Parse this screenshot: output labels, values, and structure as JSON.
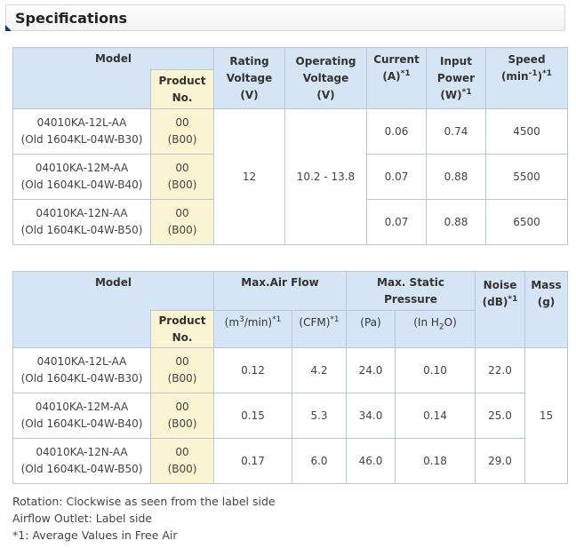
{
  "header": {
    "title": "Specifications"
  },
  "table1": {
    "headers": {
      "model": "Model",
      "product_no_l1": "Product",
      "product_no_l2": "No.",
      "rating_voltage_l1": "Rating",
      "rating_voltage_l2": "Voltage",
      "rating_voltage_l3": "(V)",
      "operating_voltage_l1": "Operating",
      "operating_voltage_l2": "Voltage",
      "operating_voltage_l3": "(V)",
      "current_l1": "Current",
      "current_l2": "(A)",
      "current_sup": "*1",
      "input_power_l1": "Input",
      "input_power_l2": "Power",
      "input_power_l3": "(W)",
      "input_power_sup": "*1",
      "speed_l1": "Speed",
      "speed_l2a": "(min",
      "speed_exp": "-1",
      "speed_l2b": ")",
      "speed_sup": "*1"
    },
    "rows": [
      {
        "model": "04010KA-12L-AA",
        "old": "(Old 1604KL-04W-B30)",
        "prod": "00",
        "prod_old": "(B00)",
        "current": "0.06",
        "power": "0.74",
        "speed": "4500"
      },
      {
        "model": "04010KA-12M-AA",
        "old": "(Old 1604KL-04W-B40)",
        "prod": "00",
        "prod_old": "(B00)",
        "current": "0.07",
        "power": "0.88",
        "speed": "5500"
      },
      {
        "model": "04010KA-12N-AA",
        "old": "(Old 1604KL-04W-B50)",
        "prod": "00",
        "prod_old": "(B00)",
        "current": "0.07",
        "power": "0.88",
        "speed": "6500"
      }
    ],
    "rating_voltage": "12",
    "operating_voltage": "10.2 - 13.8"
  },
  "table2": {
    "headers": {
      "model": "Model",
      "product_no_l1": "Product",
      "product_no_l2": "No.",
      "airflow": "Max.Air Flow",
      "m3_a": "(m",
      "m3_exp": "3",
      "m3_b": "/min)",
      "m3_sup": "*1",
      "cfm": "(CFM)",
      "cfm_sup": "*1",
      "pressure_l1": "Max. Static",
      "pressure_l2": "Pressure",
      "pa": "(Pa)",
      "inh2o_a": "(In H",
      "inh2o_sub": "2",
      "inh2o_b": "O)",
      "noise_l1": "Noise",
      "noise_l2": "(dB)",
      "noise_sup": "*1",
      "mass_l1": "Mass",
      "mass_l2": "(g)"
    },
    "rows": [
      {
        "model": "04010KA-12L-AA",
        "old": "(Old 1604KL-04W-B30)",
        "prod": "00",
        "prod_old": "(B00)",
        "m3": "0.12",
        "cfm": "4.2",
        "pa": "24.0",
        "inh2o": "0.10",
        "noise": "22.0"
      },
      {
        "model": "04010KA-12M-AA",
        "old": "(Old 1604KL-04W-B40)",
        "prod": "00",
        "prod_old": "(B00)",
        "m3": "0.15",
        "cfm": "5.3",
        "pa": "34.0",
        "inh2o": "0.14",
        "noise": "25.0"
      },
      {
        "model": "04010KA-12N-AA",
        "old": "(Old 1604KL-04W-B50)",
        "prod": "00",
        "prod_old": "(B00)",
        "m3": "0.17",
        "cfm": "6.0",
        "pa": "46.0",
        "inh2o": "0.18",
        "noise": "29.0"
      }
    ],
    "mass": "15"
  },
  "footnotes": {
    "rotation": "Rotation: Clockwise as seen from the label side",
    "airflow_outlet": "Airflow Outlet: Label side",
    "note1": "*1: Average Values in Free Air"
  },
  "colors": {
    "header_bg": "#d5e5f5",
    "product_bg": "#fbf4d3",
    "border": "#b9c6d3",
    "corner_accent": "#1a3a6e"
  }
}
